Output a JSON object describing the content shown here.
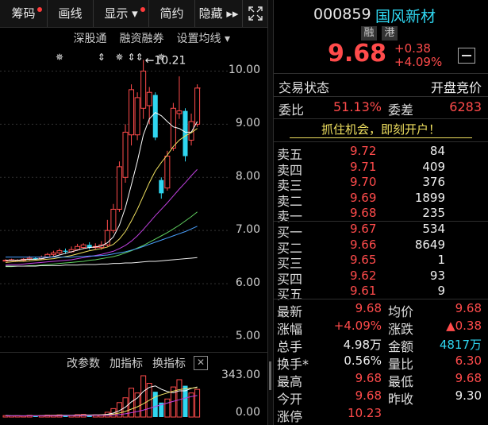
{
  "toolbar": {
    "items": [
      {
        "label": "筹码",
        "dot": true
      },
      {
        "label": "画线",
        "dot": false
      },
      {
        "label": "显示 ▾",
        "dot": true
      },
      {
        "label": "简约",
        "dot": false
      },
      {
        "label": "隐藏 ▸▸",
        "dot": false
      }
    ],
    "fullscreen_icon": "expand-icon"
  },
  "subbar": [
    "深股通",
    "融资融券",
    "设置均线 ▾"
  ],
  "chart": {
    "price_ticks": [
      "10.00",
      "9.00",
      "8.00",
      "7.00",
      "6.00",
      "5.00"
    ],
    "volume_ticks": [
      "343.00",
      "0.00"
    ],
    "high_annotation": "←10.21",
    "event_markers": [
      "✵",
      "⇕",
      "✵",
      "⇕⇕",
      "✵"
    ],
    "volume_toolbar": [
      "改参数",
      "加指标",
      "换指标"
    ],
    "volume_close_icon": "close-icon"
  },
  "chart_data": {
    "type": "candlestick",
    "title": "",
    "xlabel": "",
    "ylabel": "",
    "ylim": [
      5.0,
      10.5
    ],
    "candles": [
      {
        "o": 6.44,
        "c": 6.44,
        "h": 6.46,
        "l": 6.42
      },
      {
        "o": 6.45,
        "c": 6.45,
        "h": 6.47,
        "l": 6.43
      },
      {
        "o": 6.42,
        "c": 6.44,
        "h": 6.46,
        "l": 6.41
      },
      {
        "o": 6.44,
        "c": 6.46,
        "h": 6.48,
        "l": 6.43
      },
      {
        "o": 6.46,
        "c": 6.48,
        "h": 6.52,
        "l": 6.44
      },
      {
        "o": 6.48,
        "c": 6.47,
        "h": 6.5,
        "l": 6.45
      },
      {
        "o": 6.47,
        "c": 6.5,
        "h": 6.53,
        "l": 6.46
      },
      {
        "o": 6.5,
        "c": 6.55,
        "h": 6.58,
        "l": 6.48
      },
      {
        "o": 6.55,
        "c": 6.58,
        "h": 6.62,
        "l": 6.52
      },
      {
        "o": 6.58,
        "c": 6.62,
        "h": 6.66,
        "l": 6.55
      },
      {
        "o": 6.62,
        "c": 6.6,
        "h": 6.66,
        "l": 6.56
      },
      {
        "o": 6.6,
        "c": 6.64,
        "h": 6.7,
        "l": 6.58
      },
      {
        "o": 6.64,
        "c": 6.7,
        "h": 6.75,
        "l": 6.62
      },
      {
        "o": 6.68,
        "c": 6.73,
        "h": 6.76,
        "l": 6.65
      },
      {
        "o": 6.73,
        "c": 6.68,
        "h": 6.78,
        "l": 6.64
      },
      {
        "o": 6.68,
        "c": 6.7,
        "h": 6.76,
        "l": 6.65
      },
      {
        "o": 6.68,
        "c": 6.73,
        "h": 6.8,
        "l": 6.64
      },
      {
        "o": 6.73,
        "c": 7.0,
        "h": 7.2,
        "l": 6.7
      },
      {
        "o": 7.0,
        "c": 7.4,
        "h": 7.5,
        "l": 6.95
      },
      {
        "o": 7.4,
        "c": 8.2,
        "h": 8.3,
        "l": 7.35
      },
      {
        "o": 8.0,
        "c": 8.85,
        "h": 9.0,
        "l": 7.9
      },
      {
        "o": 8.8,
        "c": 9.65,
        "h": 9.75,
        "l": 8.6
      },
      {
        "o": 8.8,
        "c": 9.5,
        "h": 9.6,
        "l": 8.7
      },
      {
        "o": 9.3,
        "c": 10.0,
        "h": 10.21,
        "l": 9.1
      },
      {
        "o": 9.35,
        "c": 9.6,
        "h": 9.7,
        "l": 9.0
      },
      {
        "o": 9.55,
        "c": 8.75,
        "h": 9.6,
        "l": 8.7
      },
      {
        "o": 7.95,
        "c": 7.7,
        "h": 8.0,
        "l": 7.6
      },
      {
        "o": 7.8,
        "c": 8.4,
        "h": 8.5,
        "l": 7.75
      },
      {
        "o": 8.55,
        "c": 9.3,
        "h": 9.4,
        "l": 8.5
      },
      {
        "o": 9.2,
        "c": 9.25,
        "h": 9.9,
        "l": 9.1
      },
      {
        "o": 9.25,
        "c": 8.4,
        "h": 9.3,
        "l": 8.3
      },
      {
        "o": 8.7,
        "c": 9.05,
        "h": 9.2,
        "l": 8.6
      },
      {
        "o": 9.0,
        "c": 9.68,
        "h": 9.75,
        "l": 8.95
      }
    ],
    "volumes": [
      12,
      10,
      11,
      9,
      14,
      10,
      12,
      16,
      15,
      18,
      13,
      14,
      20,
      22,
      16,
      18,
      19,
      40,
      70,
      120,
      160,
      240,
      200,
      343,
      280,
      210,
      120,
      150,
      250,
      310,
      260,
      200,
      230
    ],
    "ma_series": [
      {
        "color": "#ffffff",
        "values": [
          6.44,
          6.44,
          6.44,
          6.45,
          6.46,
          6.46,
          6.47,
          6.49,
          6.51,
          6.54,
          6.57,
          6.6,
          6.63,
          6.66,
          6.68,
          6.69,
          6.71,
          6.77,
          6.88,
          7.1,
          7.43,
          7.86,
          8.3,
          8.8,
          9.1,
          9.22,
          9.16,
          9.05,
          8.95,
          8.92,
          8.85,
          8.85,
          9.05
        ]
      },
      {
        "color": "#f0e060",
        "values": [
          6.4,
          6.41,
          6.42,
          6.42,
          6.43,
          6.44,
          6.45,
          6.46,
          6.47,
          6.49,
          6.51,
          6.53,
          6.56,
          6.59,
          6.62,
          6.64,
          6.66,
          6.69,
          6.74,
          6.84,
          6.98,
          7.18,
          7.4,
          7.65,
          7.9,
          8.12,
          8.28,
          8.42,
          8.58,
          8.7,
          8.78,
          8.84,
          8.92
        ]
      },
      {
        "color": "#c040e0",
        "values": [
          6.35,
          6.36,
          6.36,
          6.37,
          6.38,
          6.39,
          6.4,
          6.41,
          6.42,
          6.43,
          6.44,
          6.45,
          6.47,
          6.49,
          6.51,
          6.53,
          6.55,
          6.58,
          6.61,
          6.66,
          6.72,
          6.8,
          6.9,
          7.02,
          7.15,
          7.28,
          7.4,
          7.52,
          7.65,
          7.78,
          7.9,
          8.03,
          8.15
        ]
      },
      {
        "color": "#60d060",
        "values": [
          6.32,
          6.32,
          6.33,
          6.33,
          6.34,
          6.34,
          6.35,
          6.36,
          6.37,
          6.38,
          6.39,
          6.4,
          6.41,
          6.42,
          6.44,
          6.45,
          6.47,
          6.49,
          6.51,
          6.54,
          6.58,
          6.62,
          6.67,
          6.72,
          6.78,
          6.84,
          6.9,
          6.96,
          7.03,
          7.1,
          7.18,
          7.26,
          7.35
        ]
      },
      {
        "color": "#4aa0ff",
        "values": [
          6.5,
          6.5,
          6.5,
          6.5,
          6.5,
          6.5,
          6.5,
          6.5,
          6.5,
          6.5,
          6.5,
          6.5,
          6.51,
          6.51,
          6.52,
          6.52,
          6.53,
          6.54,
          6.56,
          6.58,
          6.6,
          6.63,
          6.66,
          6.7,
          6.74,
          6.78,
          6.82,
          6.86,
          6.9,
          6.94,
          6.98,
          7.03,
          7.08
        ]
      },
      {
        "color": "#f0f0f0",
        "values": [
          6.33,
          6.33,
          6.33,
          6.33,
          6.33,
          6.33,
          6.34,
          6.34,
          6.34,
          6.34,
          6.35,
          6.35,
          6.35,
          6.36,
          6.36,
          6.36,
          6.37,
          6.37,
          6.38,
          6.38,
          6.39,
          6.39,
          6.4,
          6.41,
          6.42,
          6.42,
          6.43,
          6.44,
          6.45,
          6.46,
          6.47,
          6.48,
          6.49
        ]
      }
    ],
    "vol_ma_series": [
      {
        "color": "#ffffff",
        "values": [
          12,
          11,
          11,
          10,
          11,
          11,
          11,
          12,
          13,
          15,
          15,
          15,
          16,
          17,
          17,
          18,
          19,
          23,
          33,
          53,
          82,
          126,
          158,
          213,
          247,
          259,
          231,
          212,
          202,
          218,
          218,
          238,
          250
        ]
      },
      {
        "color": "#f0e060",
        "values": [
          11,
          11,
          11,
          11,
          11,
          11,
          11,
          12,
          12,
          13,
          13,
          13,
          14,
          15,
          15,
          16,
          17,
          19,
          24,
          34,
          47,
          66,
          85,
          110,
          140,
          168,
          185,
          200,
          215,
          228,
          235,
          240,
          245
        ]
      },
      {
        "color": "#c040e0",
        "values": [
          10,
          10,
          10,
          10,
          10,
          10,
          10,
          11,
          11,
          11,
          12,
          12,
          12,
          13,
          13,
          14,
          14,
          15,
          17,
          21,
          27,
          36,
          46,
          58,
          72,
          88,
          102,
          116,
          130,
          144,
          158,
          170,
          180
        ]
      }
    ]
  },
  "quote": {
    "code": "000859",
    "name": "国风新材",
    "tag_rong": "融",
    "tag_gang": "港",
    "price": "9.68",
    "change": "+0.38",
    "change_pct": "+4.09%",
    "minus_icon": "minus-icon"
  },
  "trade_status": {
    "label": "交易状态",
    "value": "开盘竞价"
  },
  "weibi": {
    "label": "委比",
    "value": "51.13%",
    "label2": "委差",
    "value2": "6283"
  },
  "promo": "抓住机会，即刻开户！",
  "sell": [
    {
      "label": "卖五",
      "price": "9.72",
      "vol": "84"
    },
    {
      "label": "卖四",
      "price": "9.71",
      "vol": "409"
    },
    {
      "label": "卖三",
      "price": "9.70",
      "vol": "376"
    },
    {
      "label": "卖二",
      "price": "9.69",
      "vol": "1899"
    },
    {
      "label": "卖一",
      "price": "9.68",
      "vol": "235"
    }
  ],
  "buy": [
    {
      "label": "买一",
      "price": "9.67",
      "vol": "534"
    },
    {
      "label": "买二",
      "price": "9.66",
      "vol": "8649"
    },
    {
      "label": "买三",
      "price": "9.65",
      "vol": "1"
    },
    {
      "label": "买四",
      "price": "9.62",
      "vol": "93"
    },
    {
      "label": "买五",
      "price": "9.61",
      "vol": "9"
    }
  ],
  "stats": [
    {
      "l1": "最新",
      "v1": "9.68",
      "c1": "red",
      "l2": "均价",
      "v2": "9.68",
      "c2": "red"
    },
    {
      "l1": "涨幅",
      "v1": "+4.09%",
      "c1": "red",
      "l2": "涨跌",
      "v2": "▲0.38",
      "c2": "red"
    },
    {
      "l1": "总手",
      "v1": "4.98万",
      "c1": "white",
      "l2": "金额",
      "v2": "4817万",
      "c2": "cyan"
    },
    {
      "l1": "换手*",
      "v1": "0.56%",
      "c1": "white",
      "l2": "量比",
      "v2": "6.30",
      "c2": "red"
    },
    {
      "l1": "最高",
      "v1": "9.68",
      "c1": "red",
      "l2": "最低",
      "v2": "9.68",
      "c2": "red"
    },
    {
      "l1": "今开",
      "v1": "9.68",
      "c1": "red",
      "l2": "昨收",
      "v2": "9.30",
      "c2": "white"
    },
    {
      "l1": "涨停",
      "v1": "10.23",
      "c1": "red",
      "l2": "",
      "v2": "",
      "c2": "white"
    }
  ]
}
